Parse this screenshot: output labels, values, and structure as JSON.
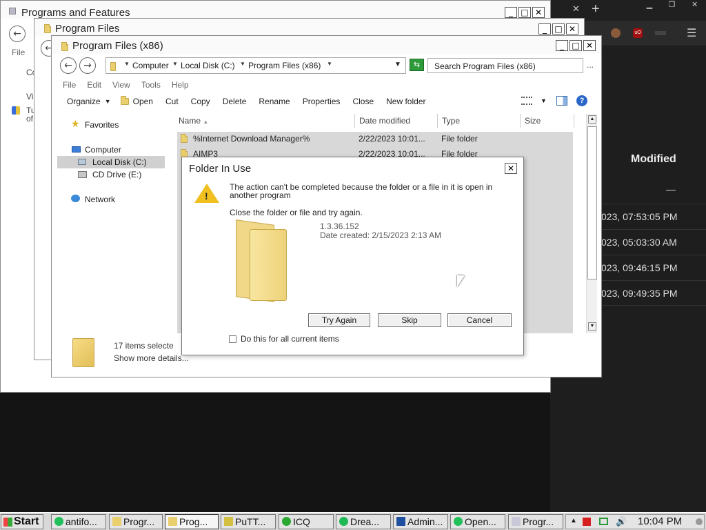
{
  "browser": {
    "new_tab_symbol": "+",
    "close_tab_symbol": "✕",
    "column_modified": "Modified",
    "dash": "—",
    "rows": [
      "023, 07:53:05 PM",
      "023, 05:03:30 AM",
      "023, 09:46:15 PM",
      "023, 09:49:35 PM"
    ],
    "menu_symbol": "☰"
  },
  "win1": {
    "title": "Programs and Features",
    "menu_file": "File",
    "side_texts": [
      "Co",
      "Vie",
      "Tu",
      "of"
    ]
  },
  "win2": {
    "title": "Program Files"
  },
  "explorer": {
    "title": "Program Files (x86)",
    "breadcrumb": [
      "Computer",
      "Local Disk (C:)",
      "Program Files (x86)"
    ],
    "search_placeholder": "Search Program Files (x86)",
    "menu": [
      "File",
      "Edit",
      "View",
      "Tools",
      "Help"
    ],
    "toolbar": {
      "organize": "Organize",
      "open": "Open",
      "cut": "Cut",
      "copy": "Copy",
      "delete": "Delete",
      "rename": "Rename",
      "properties": "Properties",
      "close": "Close",
      "new_folder": "New folder"
    },
    "nav": {
      "favorites": "Favorites",
      "computer": "Computer",
      "local_disk": "Local Disk (C:)",
      "cd_drive": "CD Drive (E:)",
      "network": "Network"
    },
    "columns": [
      "Name",
      "Date modified",
      "Type",
      "Size"
    ],
    "rows": [
      {
        "name": "%Internet Download Manager%",
        "date": "2/22/2023 10:01...",
        "type": "File folder"
      },
      {
        "name": "AIMP3",
        "date": "2/22/2023 10:01...",
        "type": "File folder"
      }
    ],
    "status_count": "17 items selecte",
    "status_more": "Show more details..."
  },
  "dialog": {
    "title": "Folder In Use",
    "message": "The action can't be completed because the folder or a file in it is open in another program",
    "hint": "Close the folder or file and try again.",
    "item_name": "1.3.36.152",
    "item_date": "Date created: 2/15/2023 2:13 AM",
    "btn_try": "Try Again",
    "btn_skip": "Skip",
    "btn_cancel": "Cancel",
    "checkbox_label": "Do this for all current items"
  },
  "taskbar": {
    "start": "Start",
    "tasks": [
      {
        "label": "antifo...",
        "color": "#22c05a"
      },
      {
        "label": "Progr...",
        "color": "#e9cf6e"
      },
      {
        "label": "Prog...",
        "color": "#e9cf6e"
      },
      {
        "label": "PuTT...",
        "color": "#d4c040"
      },
      {
        "label": "ICQ",
        "color": "#2aa832"
      },
      {
        "label": "Drea...",
        "color": "#1db954"
      },
      {
        "label": "Admin...",
        "color": "#1f4fa0"
      },
      {
        "label": "Open...",
        "color": "#22c05a"
      },
      {
        "label": "Progr...",
        "color": "#c8c8d8"
      }
    ],
    "clock": "10:04 PM"
  }
}
